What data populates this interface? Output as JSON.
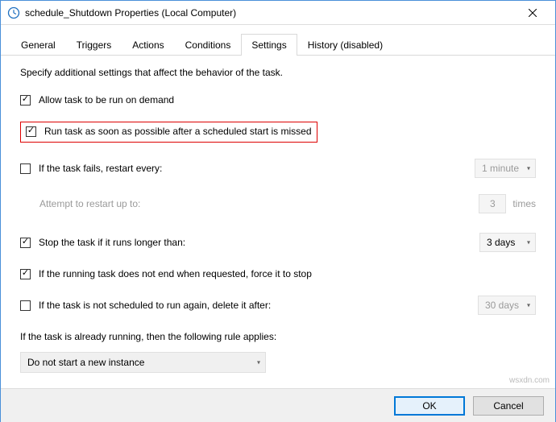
{
  "window": {
    "title": "schedule_Shutdown Properties (Local Computer)"
  },
  "tabs": {
    "general": "General",
    "triggers": "Triggers",
    "actions": "Actions",
    "conditions": "Conditions",
    "settings": "Settings",
    "history": "History (disabled)"
  },
  "settings": {
    "intro": "Specify additional settings that affect the behavior of the task.",
    "allow_on_demand": "Allow task to be run on demand",
    "run_after_missed": "Run task as soon as possible after a scheduled start is missed",
    "restart_every": "If the task fails, restart every:",
    "restart_every_value": "1 minute",
    "attempt_restart": "Attempt to restart up to:",
    "attempt_count": "3",
    "attempt_times": "times",
    "stop_if_longer": "Stop the task if it runs longer than:",
    "stop_if_longer_value": "3 days",
    "force_stop": "If the running task does not end when requested, force it to stop",
    "delete_after": "If the task is not scheduled to run again, delete it after:",
    "delete_after_value": "30 days",
    "already_running": "If the task is already running, then the following rule applies:",
    "rule_value": "Do not start a new instance"
  },
  "buttons": {
    "ok": "OK",
    "cancel": "Cancel"
  },
  "watermark": "wsxdn.com"
}
